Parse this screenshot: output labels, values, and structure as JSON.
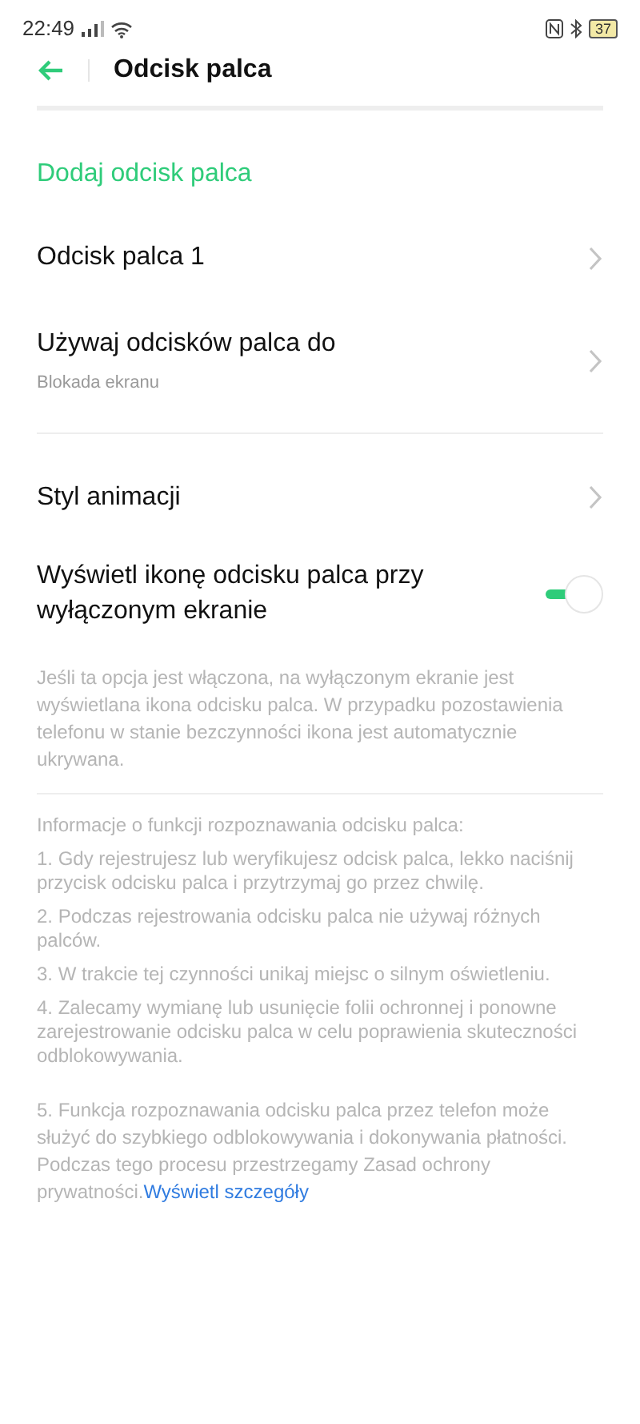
{
  "status_bar": {
    "time": "22:49",
    "battery": "37"
  },
  "header": {
    "title": "Odcisk palca"
  },
  "add_link": "Dodaj odcisk palca",
  "items": [
    {
      "kind": "nav",
      "title": "Odcisk palca 1"
    },
    {
      "kind": "nav",
      "title": "Używaj odcisków palca do",
      "subtitle": "Blokada ekranu"
    }
  ],
  "items2": [
    {
      "kind": "nav",
      "title": "Styl animacji"
    },
    {
      "kind": "toggle",
      "title": "Wyświetl ikonę odcisku palca przy wyłączonym ekranie",
      "on": true
    }
  ],
  "toggle_description": "Jeśli ta opcja jest włączona, na wyłączonym ekranie jest wyświetlana ikona odcisku palca. W przypadku pozostawienia telefonu w stanie bezczynności ikona jest automatycznie ukrywana.",
  "info": [
    "Informacje o funkcji rozpoznawania odcisku palca:",
    "1. Gdy rejestrujesz lub weryfikujesz odcisk palca, lekko naciśnij przycisk odcisku palca i przytrzymaj go przez chwilę.",
    "2. Podczas rejestrowania odcisku palca nie używaj różnych palców.",
    "3. W trakcie tej czynności unikaj miejsc o silnym oświetleniu.",
    "4. Zalecamy wymianę lub usunięcie folii ochronnej i ponowne zarejestrowanie odcisku palca w celu poprawienia skuteczności odblokowywania."
  ],
  "privacy": {
    "text": "5. Funkcja rozpoznawania odcisku palca przez telefon może służyć do szybkiego odblokowywania i dokonywania płatności. Podczas tego procesu przestrzegamy Zasad ochrony prywatności.",
    "link": "Wyświetl szczegóły"
  }
}
